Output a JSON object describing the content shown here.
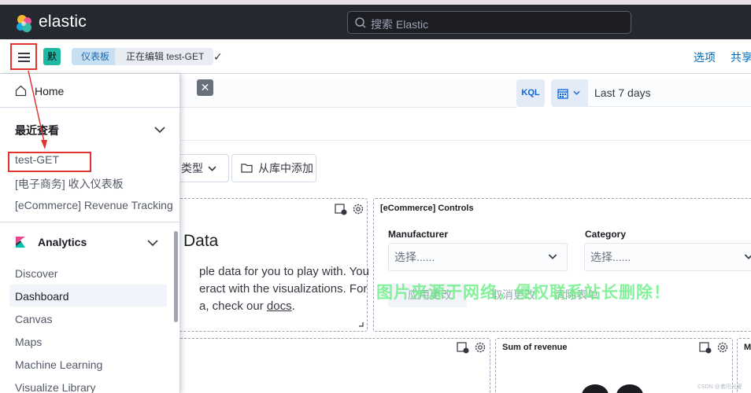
{
  "header": {
    "logo_text": "elastic",
    "search_placeholder": "搜索 Elastic"
  },
  "subbar": {
    "space_badge": "默",
    "breadcrumbs": [
      "仪表板",
      "正在编辑 test-GET"
    ],
    "check": "✓",
    "options_label": "选项",
    "share_label": "共享"
  },
  "query": {
    "kql_label": "KQL",
    "date_range": "Last 7 days",
    "clear_label": "✕"
  },
  "toolbar": {
    "type_label": "类型",
    "add_from_library_label": "从库中添加"
  },
  "panels": {
    "welcome": {
      "title": "Data",
      "lines": [
        "ple data for you to play with. You",
        "eract with the visualizations. For",
        "a, check our "
      ],
      "docs_link": "docs",
      "docs_suffix": "."
    },
    "controls": {
      "title": "[eCommerce] Controls",
      "manufacturer_label": "Manufacturer",
      "category_label": "Category",
      "manufacturer_placeholder": "选择......",
      "category_placeholder": "选择......",
      "apply_label": "应用更改",
      "cancel_label": "取消更改",
      "clear_label": "清除表单"
    },
    "revenue": {
      "title": "Sum of revenue"
    },
    "m_panel": {
      "title": "M"
    }
  },
  "watermark": "图片来源于网络，侵权联系站长删除！",
  "footer_credit": "CSDN @着阳光夏",
  "sidenav": {
    "home_label": "Home",
    "recent_title": "最近查看",
    "recent_items": [
      "test-GET",
      "[电子商务] 收入仪表板",
      "[eCommerce] Revenue Tracking"
    ],
    "analytics_title": "Analytics",
    "analytics_items": [
      "Discover",
      "Dashboard",
      "Canvas",
      "Maps",
      "Machine Learning",
      "Visualize Library"
    ],
    "active_item": "Dashboard"
  },
  "colors": {
    "header_bg": "#25282f",
    "accent": "#006bb8",
    "annotation_red": "#e0352f",
    "space_badge": "#20b8a5"
  }
}
